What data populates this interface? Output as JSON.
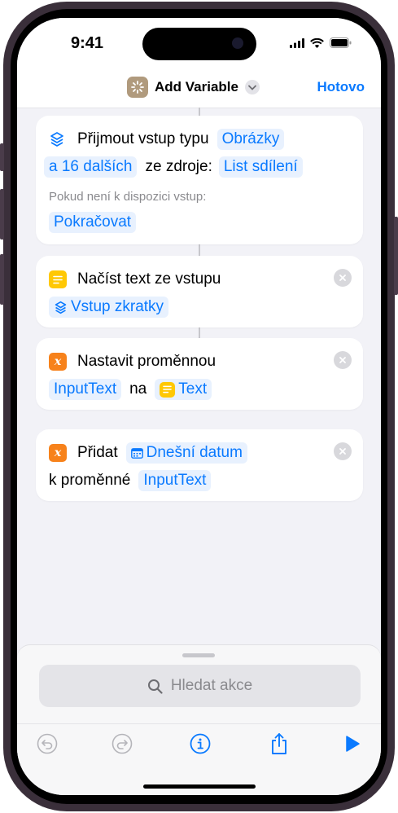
{
  "status_bar": {
    "time": "9:41"
  },
  "navbar": {
    "title": "Add Variable",
    "done_label": "Hotovo"
  },
  "actions": [
    {
      "line1_text": "Přijmout vstup typu",
      "types_token_1": "Obrázky",
      "types_token_2": "a 16 dalších",
      "source_label": "ze zdroje:",
      "source_token": "List sdílení",
      "fallback_label": "Pokud není k dispozici vstup:",
      "fallback_token": "Pokračovat"
    },
    {
      "title": "Načíst text ze vstupu",
      "input_token": "Vstup zkratky"
    },
    {
      "title": "Nastavit proměnnou",
      "variable_token": "InputText",
      "to_label": "na",
      "value_token": "Text"
    },
    {
      "title": "Přidat",
      "value_token": "Dnešní datum",
      "to_label": "k proměnné",
      "variable_token": "InputText"
    }
  ],
  "bottom_sheet": {
    "search_placeholder": "Hledat akce"
  },
  "colors": {
    "accent": "#0a7aff",
    "text_icon": "#ffc804",
    "variable_icon": "#f7821b",
    "shortcut_icon": "#b09a7d"
  }
}
